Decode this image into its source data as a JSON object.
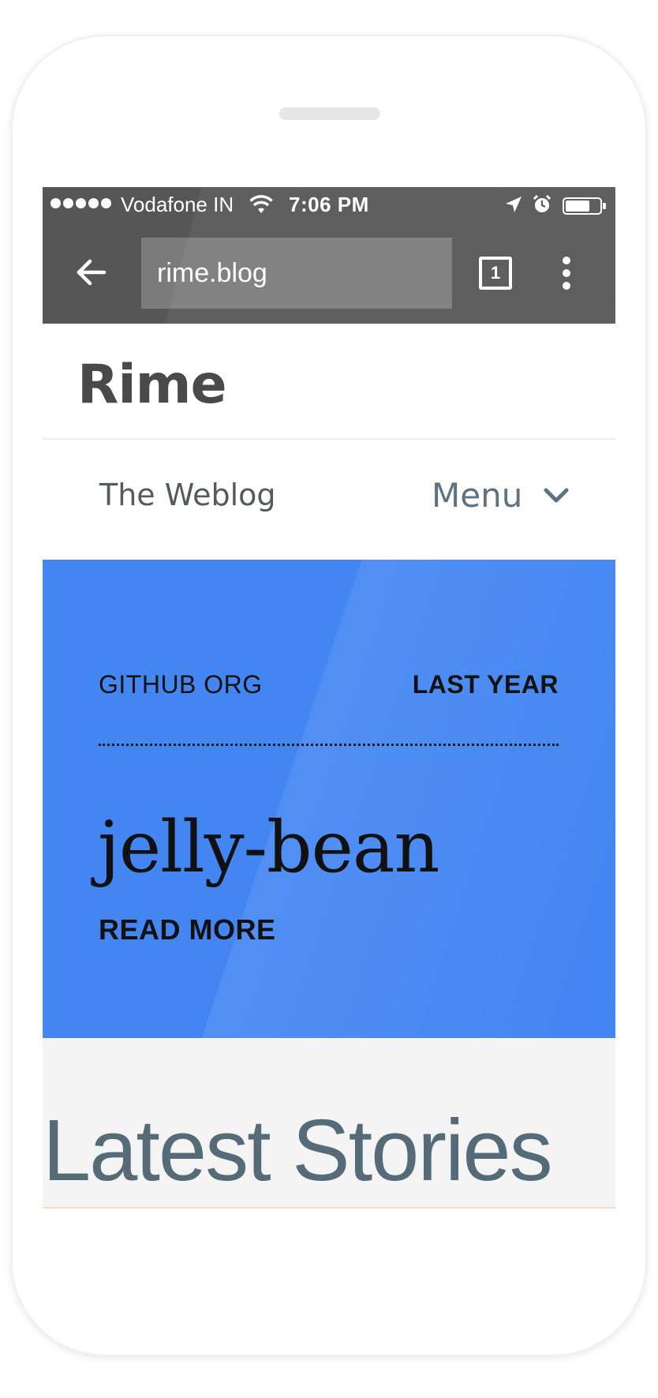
{
  "status_bar": {
    "carrier": "Vodafone IN",
    "time": "7:06 PM"
  },
  "browser": {
    "url": "rime.blog",
    "tab_count": "1"
  },
  "site": {
    "logo": "Rime",
    "tagline": "The Weblog",
    "menu_label": "Menu"
  },
  "hero": {
    "org": "GITHUB ORG",
    "date": "LAST YEAR",
    "title": "jelly-bean",
    "read_more": "READ MORE",
    "background_color": "#4386f2"
  },
  "latest": {
    "title": "Latest Stories"
  },
  "colors": {
    "chrome_bar": "#565656",
    "hero_blue": "#4386f2",
    "section_bg": "#f4f4f4"
  }
}
